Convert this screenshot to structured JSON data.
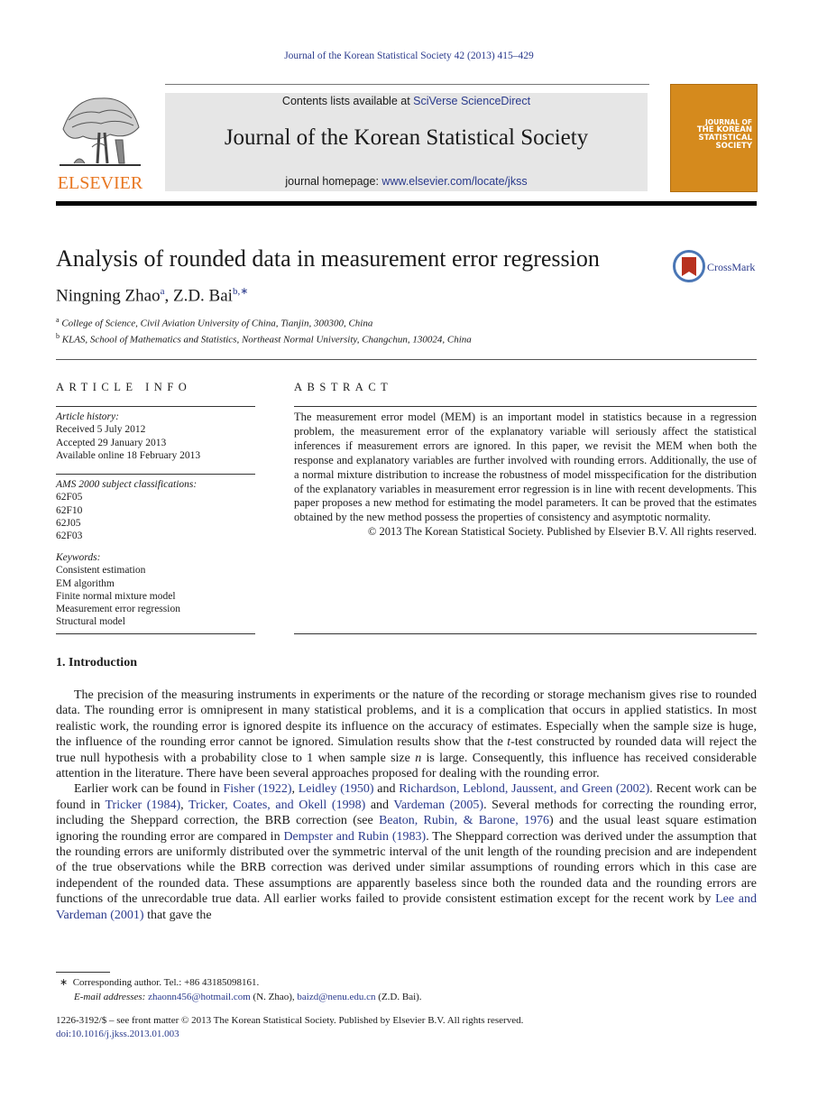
{
  "citation": "Journal of the Korean Statistical Society 42 (2013) 415–429",
  "masthead": {
    "publisher": "ELSEVIER",
    "contents_prefix": "Contents lists available at ",
    "contents_link": "SciVerse ScienceDirect",
    "journal_title": "Journal of the Korean Statistical Society",
    "homepage_prefix": "journal homepage: ",
    "homepage_link": "www.elsevier.com/locate/jkss",
    "cover_lines": [
      "JOURNAL OF",
      "THE KOREAN",
      "STATISTICAL",
      "SOCIETY"
    ],
    "cover_color": "#d58a1d",
    "publisher_color": "#e87722"
  },
  "article": {
    "title": "Analysis of rounded data in measurement error regression",
    "crossmark_label": "CrossMark",
    "authors": [
      {
        "name": "Ningning Zhao",
        "sup": "a"
      },
      {
        "name": "Z.D. Bai",
        "sup": "b,∗"
      }
    ],
    "affiliations": [
      {
        "sup": "a",
        "text": "College of Science, Civil Aviation University of China, Tianjin, 300300, China"
      },
      {
        "sup": "b",
        "text": "KLAS, School of Mathematics and Statistics, Northeast Normal University, Changchun, 130024, China"
      }
    ]
  },
  "article_info": {
    "heading": "ARTICLE INFO",
    "history_label": "Article history:",
    "history": [
      "Received 5 July 2012",
      "Accepted 29 January 2013",
      "Available online 18 February 2013"
    ],
    "ams_label": "AMS 2000 subject classifications:",
    "ams": [
      "62F05",
      "62F10",
      "62J05",
      "62F03"
    ],
    "keywords_label": "Keywords:",
    "keywords": [
      "Consistent estimation",
      "EM algorithm",
      "Finite normal mixture model",
      "Measurement error regression",
      "Structural model"
    ]
  },
  "abstract": {
    "heading": "ABSTRACT",
    "text": "The measurement error model (MEM) is an important model in statistics because in a regression problem, the measurement error of the explanatory variable will seriously affect the statistical inferences if measurement errors are ignored. In this paper, we revisit the MEM when both the response and explanatory variables are further involved with rounding errors. Additionally, the use of a normal mixture distribution to increase the robustness of model misspecification for the distribution of the explanatory variables in measurement error regression is in line with recent developments. This paper proposes a new method for estimating the model parameters. It can be proved that the estimates obtained by the new method possess the properties of consistency and asymptotic normality.",
    "copyright": "© 2013 The Korean Statistical Society. Published by Elsevier B.V. All rights reserved."
  },
  "introduction": {
    "heading": "1.  Introduction",
    "p1": {
      "a": "The precision of the measuring instruments in experiments or the nature of the recording or storage mechanism gives rise to rounded data. The rounding error is omnipresent in many statistical problems, and it is a complication that occurs in applied statistics. In most realistic work, the rounding error is ignored despite its influence on the accuracy of estimates. Especially when the sample size is huge, the influence of the rounding error cannot be ignored. Simulation results show that the ",
      "t": "t",
      "b": "-test constructed by rounded data will reject the true null hypothesis with a probability close to 1 when sample size ",
      "n": "n",
      "c": " is large. Consequently, this influence has received considerable attention in the literature. There have been several approaches proposed for dealing with the rounding error."
    },
    "p2": {
      "s1": "Earlier work can be found in ",
      "r1": "Fisher (1922)",
      "s2": ", ",
      "r2": "Leidley (1950)",
      "s3": " and ",
      "r3": "Richardson, Leblond, Jaussent, and Green (2002)",
      "s4": ". Recent work can be found in ",
      "r4": "Tricker (1984)",
      "s5": ", ",
      "r5": "Tricker, Coates, and Okell (1998)",
      "s6": " and ",
      "r6": "Vardeman (2005)",
      "s7": ". Several methods for correcting the rounding error, including the Sheppard correction, the BRB correction (see ",
      "r7": "Beaton, Rubin, & Barone, 1976",
      "s8": ") and the usual least square estimation ignoring the rounding error are compared in ",
      "r8": "Dempster and Rubin (1983)",
      "s9": ". The Sheppard correction was derived under the assumption that the rounding errors are uniformly distributed over the symmetric interval of the unit length of the rounding precision and are independent of the true observations while the BRB correction was derived under similar assumptions of rounding errors which in this case are independent of the rounded data. These assumptions are apparently baseless since both the rounded data and the rounding errors are functions of the unrecordable true data. All earlier works failed to provide consistent estimation except for the recent work by ",
      "r9": "Lee and Vardeman (2001)",
      "s10": " that gave the"
    }
  },
  "footnotes": {
    "star": "∗",
    "corresponding": "Corresponding author. Tel.: +86 43185098161.",
    "email_label": "E-mail addresses: ",
    "email1": "zhaonn456@hotmail.com",
    "email1_owner": " (N. Zhao), ",
    "email2": "baizd@nenu.edu.cn",
    "email2_owner": " (Z.D. Bai).",
    "issn_line": "1226-3192/$ – see front matter © 2013 The Korean Statistical Society. Published by Elsevier B.V. All rights reserved.",
    "doi": "doi:10.1016/j.jkss.2013.01.003"
  }
}
